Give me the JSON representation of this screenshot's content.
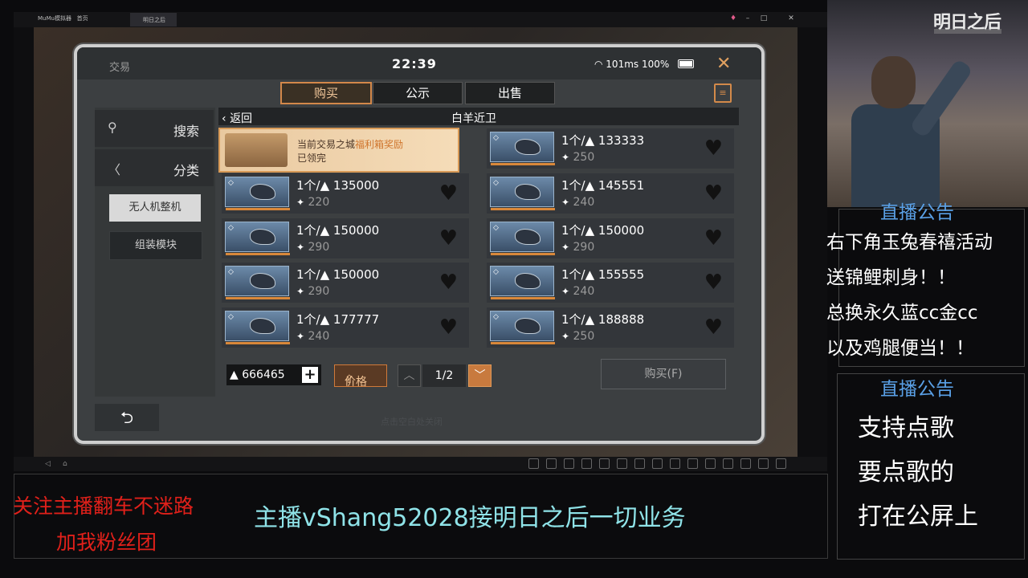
{
  "emulator": {
    "app_tab": "MuMu模拟器",
    "home_tab": "首页",
    "game_tab": "明日之后",
    "controls": [
      "♦",
      "–",
      "□",
      "✕"
    ]
  },
  "game": {
    "panel_title": "交易",
    "clock": "22:39",
    "status": "101ms 100%",
    "tabs": [
      {
        "label": "购买",
        "active": true
      },
      {
        "label": "公示",
        "active": false
      },
      {
        "label": "出售",
        "active": false
      }
    ],
    "sidebar": {
      "search_label": "搜索",
      "category_label": "分类",
      "sub_items": [
        "无人机整机",
        "组装模块"
      ]
    },
    "list": {
      "back_label": "返回",
      "title": "白羊近卫"
    },
    "reward": {
      "line1_prefix": "当前交易之城",
      "line1_highlight": "福利箱奖励",
      "line2": "已领完"
    },
    "items": [
      {
        "price": "1个/▲ 133333",
        "rate": "250"
      },
      {
        "price": "1个/▲ 135000",
        "rate": "220"
      },
      {
        "price": "1个/▲ 145551",
        "rate": "240"
      },
      {
        "price": "1个/▲ 150000",
        "rate": "290"
      },
      {
        "price": "1个/▲ 150000",
        "rate": "290"
      },
      {
        "price": "1个/▲ 150000",
        "rate": "290"
      },
      {
        "price": "1个/▲ 155555",
        "rate": "240"
      },
      {
        "price": "1个/▲ 177777",
        "rate": "240"
      },
      {
        "price": "1个/▲ 188888",
        "rate": "250"
      }
    ],
    "balance": "▲ 666465",
    "price_sort_label": "价格",
    "page": "1/2",
    "buy_button": "购买(F)",
    "close_hint": "点击空白处关闭"
  },
  "overlay": {
    "logo": "明日之后",
    "announcement_title": "直播公告",
    "announcement_lines": [
      "右下角玉兔春禧活动",
      "送锦鲤刺身！！",
      "总换永久蓝cc金cc",
      "以及鸡腿便当！！"
    ],
    "announcement2_title": "直播公告",
    "announcement2_lines": [
      "支持点歌",
      "要点歌的",
      "打在公屏上"
    ]
  },
  "banner": {
    "follow_line1": "关注主播翻车不迷路",
    "follow_line2": "加我粉丝团",
    "business": "主播vShang52028接明日之后一切业务"
  },
  "colors": {
    "accent_orange": "#d3884a",
    "banner_red": "#e0201a",
    "banner_cyan": "#8fe3e8",
    "announcement_blue": "#5aa0e6"
  }
}
